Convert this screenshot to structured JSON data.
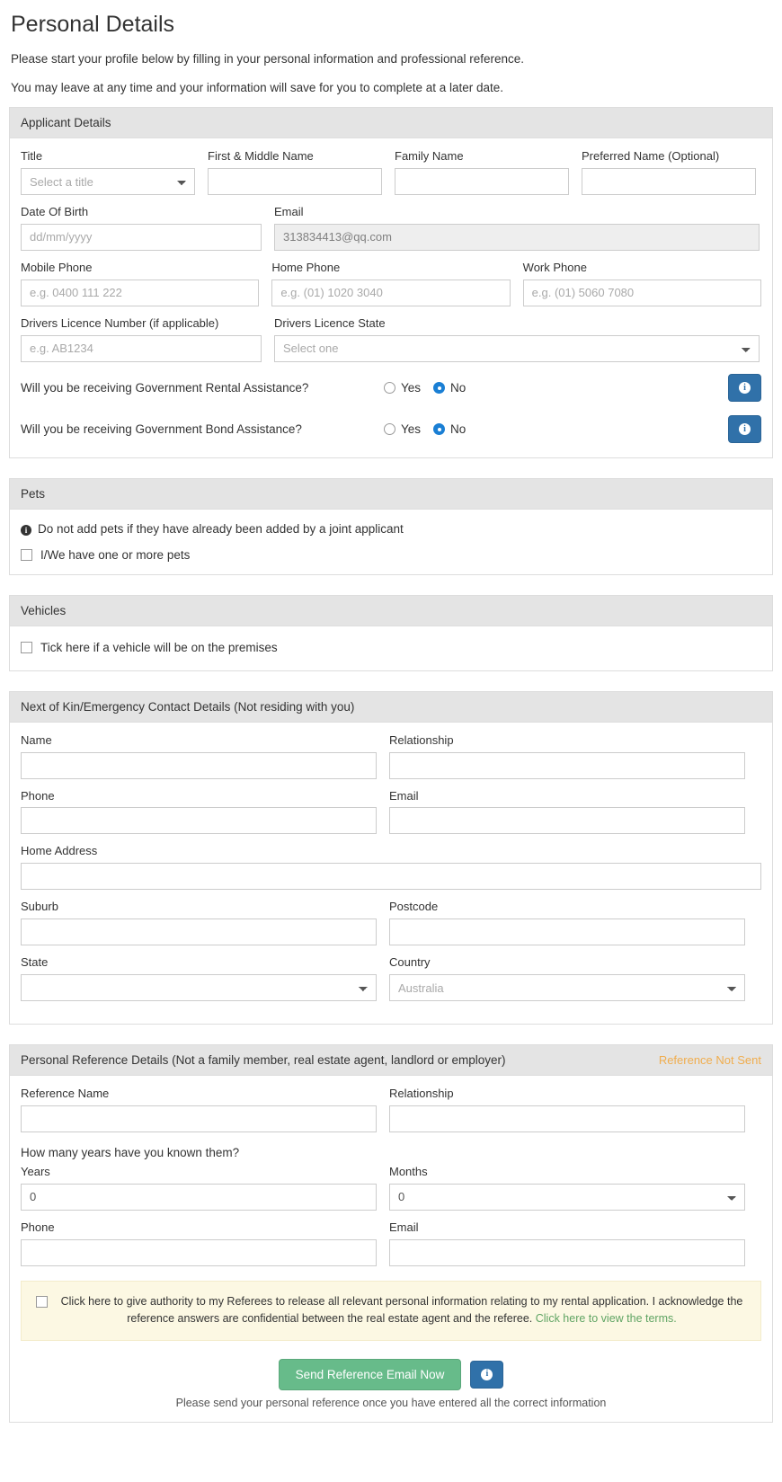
{
  "header": {
    "title": "Personal Details",
    "intro_1": "Please start your profile below by filling in your personal information and professional reference.",
    "intro_2": "You may leave at any time and your information will save for you to complete at a later date."
  },
  "applicant": {
    "section_title": "Applicant Details",
    "title_label": "Title",
    "title_value": "Select a title",
    "first_name_label": "First & Middle Name",
    "first_name_value": "",
    "family_name_label": "Family Name",
    "family_name_value": "",
    "preferred_name_label": "Preferred Name (Optional)",
    "preferred_name_value": "",
    "dob_label": "Date Of Birth",
    "dob_placeholder": "dd/mm/yyyy",
    "email_label": "Email",
    "email_value": "313834413@qq.com",
    "mobile_label": "Mobile Phone",
    "mobile_placeholder": "e.g. 0400 111 222",
    "home_phone_label": "Home Phone",
    "home_phone_placeholder": "e.g. (01) 1020 3040",
    "work_phone_label": "Work Phone",
    "work_phone_placeholder": "e.g. (01) 5060 7080",
    "licence_number_label": "Drivers Licence Number (if applicable)",
    "licence_number_placeholder": "e.g. AB1234",
    "licence_state_label": "Drivers Licence State",
    "licence_state_value": "Select one",
    "rental_assistance_question": "Will you be receiving Government Rental Assistance?",
    "bond_assistance_question": "Will you be receiving Government Bond Assistance?",
    "yes_label": "Yes",
    "no_label": "No",
    "rental_assistance_selected": "No",
    "bond_assistance_selected": "No",
    "info_glyph": "i"
  },
  "pets": {
    "section_title": "Pets",
    "note": "Do not add pets if they have already been added by a joint applicant",
    "checkbox_label": "I/We have one or more pets",
    "checked": false
  },
  "vehicles": {
    "section_title": "Vehicles",
    "checkbox_label": "Tick here if a vehicle will be on the premises",
    "checked": false
  },
  "next_of_kin": {
    "section_title": "Next of Kin/Emergency Contact Details (Not residing with you)",
    "name_label": "Name",
    "name_value": "",
    "relationship_label": "Relationship",
    "relationship_value": "",
    "phone_label": "Phone",
    "phone_value": "",
    "email_label": "Email",
    "email_value": "",
    "home_address_label": "Home Address",
    "home_address_value": "",
    "suburb_label": "Suburb",
    "suburb_value": "",
    "postcode_label": "Postcode",
    "postcode_value": "",
    "state_label": "State",
    "state_value": "",
    "country_label": "Country",
    "country_value": "Australia"
  },
  "reference": {
    "section_title": "Personal Reference Details (Not a family member, real estate agent, landlord or employer)",
    "status_badge": "Reference Not Sent",
    "status_color": "#f0ad4e",
    "name_label": "Reference Name",
    "name_value": "",
    "relationship_label": "Relationship",
    "relationship_value": "",
    "known_question": "How many years have you known them?",
    "years_label": "Years",
    "years_value": "0",
    "months_label": "Months",
    "months_value": "0",
    "phone_label": "Phone",
    "phone_value": "",
    "email_label": "Email",
    "email_value": "",
    "terms_text": "Click here to give authority to my Referees to release all relevant personal information relating to my rental application. I acknowledge the reference answers are confidential between the real estate agent and the referee. ",
    "terms_link": "Click here to view the terms.",
    "terms_checked": false,
    "send_button": "Send Reference Email Now",
    "send_help": "Please send your personal reference once you have entered all the correct information",
    "info_glyph": "i"
  }
}
